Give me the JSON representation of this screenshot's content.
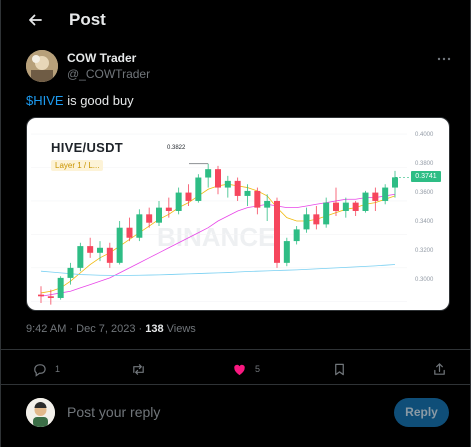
{
  "header": {
    "title": "Post"
  },
  "author": {
    "name": "COW Trader",
    "handle": "@_COWTrader"
  },
  "tweet": {
    "cashtag": "$HIVE",
    "text": " is good buy"
  },
  "chart_card": {
    "pair": "HIVE/USDT",
    "tag": "Layer 1 / L...",
    "high_label": "0.3822",
    "current_price": "0.3741",
    "price_color": "#2ebd85",
    "up_color": "#2ebd85",
    "down_color": "#f6465d",
    "ticks": [
      "0.4000",
      "0.3800",
      "0.3600",
      "0.3400",
      "0.3200",
      "0.3000"
    ]
  },
  "chart_data": {
    "type": "candlestick",
    "title": "HIVE/USDT",
    "ylim": [
      0.296,
      0.406
    ],
    "yticks": [
      0.4,
      0.38,
      0.36,
      0.34,
      0.32,
      0.3
    ],
    "candles": [
      [
        0.304,
        0.309,
        0.299,
        0.303
      ],
      [
        0.303,
        0.307,
        0.298,
        0.302
      ],
      [
        0.302,
        0.315,
        0.301,
        0.314
      ],
      [
        0.314,
        0.323,
        0.31,
        0.32
      ],
      [
        0.32,
        0.335,
        0.318,
        0.333
      ],
      [
        0.333,
        0.338,
        0.326,
        0.329
      ],
      [
        0.329,
        0.336,
        0.324,
        0.332
      ],
      [
        0.332,
        0.335,
        0.32,
        0.323
      ],
      [
        0.323,
        0.348,
        0.322,
        0.344
      ],
      [
        0.344,
        0.35,
        0.336,
        0.338
      ],
      [
        0.338,
        0.355,
        0.336,
        0.352
      ],
      [
        0.352,
        0.356,
        0.344,
        0.347
      ],
      [
        0.347,
        0.36,
        0.345,
        0.356
      ],
      [
        0.356,
        0.362,
        0.35,
        0.354
      ],
      [
        0.354,
        0.368,
        0.352,
        0.365
      ],
      [
        0.365,
        0.37,
        0.357,
        0.36
      ],
      [
        0.36,
        0.376,
        0.359,
        0.374
      ],
      [
        0.374,
        0.3822,
        0.368,
        0.379
      ],
      [
        0.379,
        0.381,
        0.364,
        0.368
      ],
      [
        0.368,
        0.375,
        0.362,
        0.372
      ],
      [
        0.372,
        0.374,
        0.36,
        0.363
      ],
      [
        0.363,
        0.37,
        0.357,
        0.366
      ],
      [
        0.366,
        0.368,
        0.352,
        0.356
      ],
      [
        0.356,
        0.364,
        0.348,
        0.36
      ],
      [
        0.36,
        0.362,
        0.32,
        0.323
      ],
      [
        0.323,
        0.338,
        0.321,
        0.336
      ],
      [
        0.336,
        0.345,
        0.334,
        0.343
      ],
      [
        0.343,
        0.356,
        0.341,
        0.352
      ],
      [
        0.352,
        0.357,
        0.343,
        0.346
      ],
      [
        0.346,
        0.362,
        0.344,
        0.359
      ],
      [
        0.359,
        0.368,
        0.351,
        0.354
      ],
      [
        0.354,
        0.362,
        0.35,
        0.359
      ],
      [
        0.359,
        0.36,
        0.351,
        0.354
      ],
      [
        0.354,
        0.366,
        0.353,
        0.365
      ],
      [
        0.365,
        0.368,
        0.354,
        0.36
      ],
      [
        0.36,
        0.37,
        0.358,
        0.368
      ],
      [
        0.368,
        0.378,
        0.362,
        0.3741
      ]
    ],
    "moving_averages": [
      {
        "color": "#f0b90b",
        "values": [
          0.305,
          0.306,
          0.308,
          0.312,
          0.317,
          0.322,
          0.326,
          0.329,
          0.333,
          0.337,
          0.341,
          0.345,
          0.349,
          0.352,
          0.356,
          0.359,
          0.363,
          0.367,
          0.369,
          0.37,
          0.369,
          0.368,
          0.366,
          0.363,
          0.356,
          0.35,
          0.348,
          0.348,
          0.349,
          0.351,
          0.353,
          0.355,
          0.356,
          0.358,
          0.359,
          0.361,
          0.363
        ]
      },
      {
        "color": "#e845e8",
        "values": [
          0.303,
          0.304,
          0.305,
          0.306,
          0.308,
          0.31,
          0.312,
          0.314,
          0.317,
          0.32,
          0.323,
          0.326,
          0.329,
          0.332,
          0.335,
          0.338,
          0.341,
          0.344,
          0.348,
          0.351,
          0.354,
          0.356,
          0.357,
          0.358,
          0.357,
          0.356,
          0.356,
          0.357,
          0.358,
          0.359,
          0.36,
          0.361,
          0.361,
          0.362,
          0.362,
          0.363,
          0.364
        ]
      },
      {
        "color": "#79d0f2",
        "values": [
          0.318,
          0.3175,
          0.317,
          0.3165,
          0.316,
          0.3158,
          0.3156,
          0.3155,
          0.3155,
          0.3155,
          0.3156,
          0.3157,
          0.3158,
          0.316,
          0.3162,
          0.3164,
          0.3166,
          0.3168,
          0.317,
          0.3172,
          0.3175,
          0.3178,
          0.318,
          0.3182,
          0.3184,
          0.3186,
          0.3188,
          0.3191,
          0.3194,
          0.3197,
          0.32,
          0.3203,
          0.3206,
          0.3209,
          0.3212,
          0.3216,
          0.322
        ]
      }
    ]
  },
  "meta": {
    "time": "9:42 AM · Dec 7, 2023 · ",
    "views_count": "138",
    "views_label": " Views"
  },
  "actions": {
    "reply_count": "1",
    "like_count": "5",
    "like_color": "#f91880"
  },
  "reply": {
    "placeholder": "Post your reply",
    "button": "Reply"
  }
}
